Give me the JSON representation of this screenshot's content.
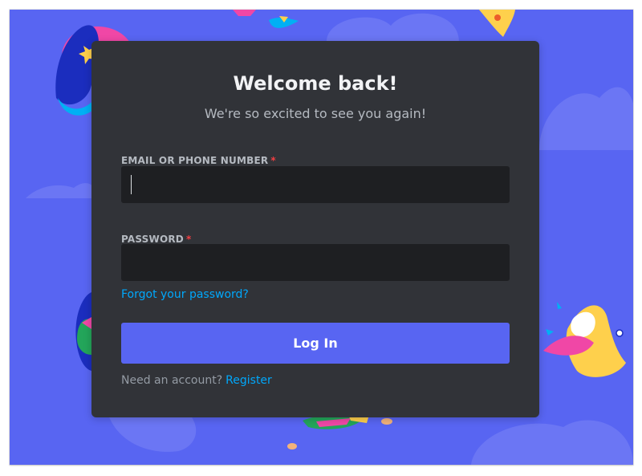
{
  "login": {
    "title": "Welcome back!",
    "subtitle": "We're so excited to see you again!",
    "email_label": "EMAIL OR PHONE NUMBER",
    "password_label": "PASSWORD",
    "required_marker": "*",
    "email_value": "",
    "password_value": "",
    "forgot_password_text": "Forgot your password?",
    "login_button_label": "Log In",
    "need_account_text": "Need an account?",
    "register_link_text": "Register"
  },
  "colors": {
    "background": "#5865f2",
    "modal": "#313338",
    "input": "#1e1f22",
    "button": "#5865f2",
    "link": "#00a8fc",
    "required": "#f23f42"
  }
}
